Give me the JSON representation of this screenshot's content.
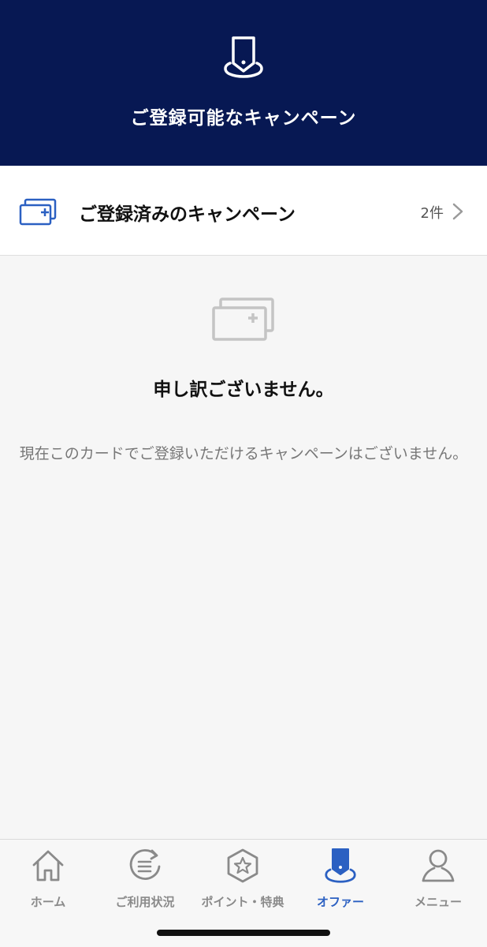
{
  "header": {
    "title": "ご登録可能なキャンペーン",
    "icon": "offer-tag-icon"
  },
  "registered": {
    "label": "ご登録済みのキャンペーン",
    "count": "2件",
    "icon": "card-plus-icon"
  },
  "empty_state": {
    "title": "申し訳ございません。",
    "message": "現在このカードでご登録いただけるキャンペーンはございません。",
    "icon": "card-plus-icon"
  },
  "tabbar": {
    "items": [
      {
        "label": "ホーム",
        "icon": "home-icon",
        "active": false
      },
      {
        "label": "ご利用状況",
        "icon": "usage-list-icon",
        "active": false
      },
      {
        "label": "ポイント・特典",
        "icon": "star-hexagon-icon",
        "active": false
      },
      {
        "label": "オファー",
        "icon": "offer-tag-icon",
        "active": true
      },
      {
        "label": "メニュー",
        "icon": "person-icon",
        "active": false
      }
    ]
  },
  "colors": {
    "header_bg": "#071853",
    "accent": "#2b60c2",
    "inactive": "#8a8a8a"
  }
}
